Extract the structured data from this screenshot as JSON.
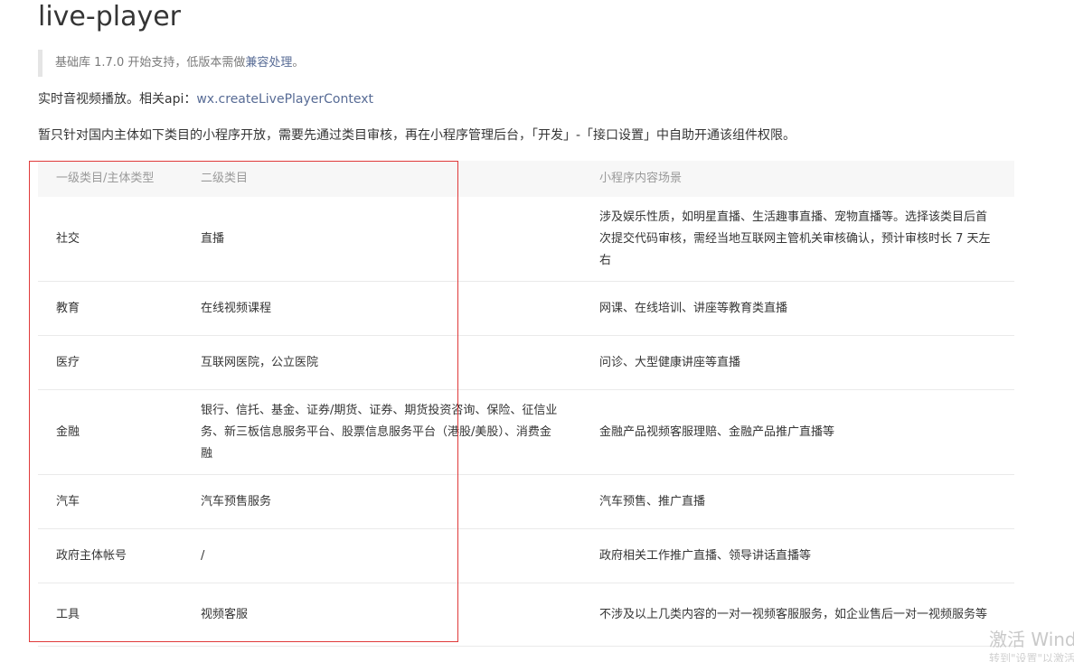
{
  "title": "live-player",
  "note": {
    "prefix": "基础库 1.7.0 开始支持，低版本需做",
    "link": "兼容处理",
    "suffix": "。"
  },
  "intro": {
    "text": "实时音视频播放。相关api：",
    "link": "wx.createLivePlayerContext"
  },
  "notice": "暂只针对国内主体如下类目的小程序开放，需要先通过类目审核，再在小程序管理后台，「开发」-「接口设置」中自助开通该组件权限。",
  "table": {
    "headers": [
      "一级类目/主体类型",
      "二级类目",
      "小程序内容场景"
    ],
    "rows": [
      {
        "c1": "社交",
        "c2": "直播",
        "c3": "涉及娱乐性质，如明星直播、生活趣事直播、宠物直播等。选择该类目后首次提交代码审核，需经当地互联网主管机关审核确认，预计审核时长 7 天左右"
      },
      {
        "c1": "教育",
        "c2": "在线视频课程",
        "c3": "网课、在线培训、讲座等教育类直播"
      },
      {
        "c1": "医疗",
        "c2": "互联网医院，公立医院",
        "c3": "问诊、大型健康讲座等直播"
      },
      {
        "c1": "金融",
        "c2": "银行、信托、基金、证券/期货、证券、期货投资咨询、保险、征信业务、新三板信息服务平台、股票信息服务平台（港股/美股）、消费金融",
        "c3": "金融产品视频客服理赔、金融产品推广直播等"
      },
      {
        "c1": "汽车",
        "c2": "汽车预售服务",
        "c3": "汽车预售、推广直播"
      },
      {
        "c1": "政府主体帐号",
        "c2": "/",
        "c3": "政府相关工作推广直播、领导讲话直播等"
      },
      {
        "c1": "工具",
        "c2": "视频客服",
        "c3": "不涉及以上几类内容的一对一视频客服服务，如企业售后一对一视频服务等"
      }
    ]
  },
  "watermark": {
    "line1": "激活 Windows",
    "line2": "转到\"设置\"以激活 Windows。"
  }
}
